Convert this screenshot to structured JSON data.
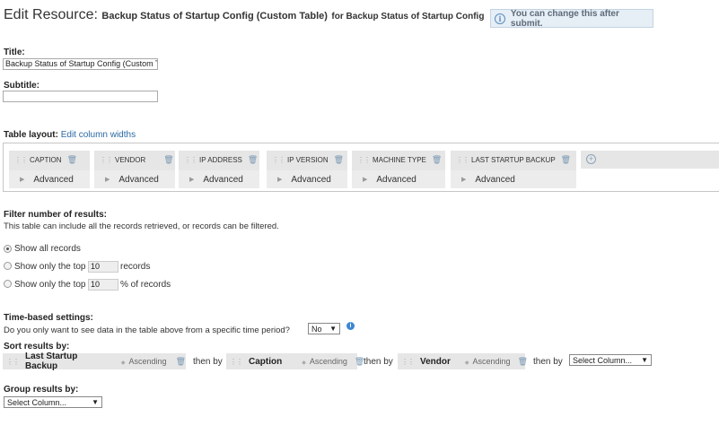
{
  "header": {
    "prefix": "Edit Resource:",
    "resource_name": "Backup Status of Startup Config (Custom Table)",
    "for_text": "for Backup Status of Startup Config",
    "hint": "You can change this after submit."
  },
  "form": {
    "title_label": "Title:",
    "title_value": "Backup Status of Startup Config (Custom Table)",
    "subtitle_label": "Subtitle:",
    "subtitle_value": ""
  },
  "table_layout": {
    "label": "Table layout:",
    "edit_link": "Edit column widths",
    "columns": [
      {
        "name": "CAPTION",
        "advanced": "Advanced"
      },
      {
        "name": "VENDOR",
        "advanced": "Advanced"
      },
      {
        "name": "IP ADDRESS",
        "advanced": "Advanced"
      },
      {
        "name": "IP VERSION",
        "advanced": "Advanced"
      },
      {
        "name": "MACHINE TYPE",
        "advanced": "Advanced"
      },
      {
        "name": "LAST STARTUP BACKUP",
        "advanced": "Advanced"
      }
    ]
  },
  "filter": {
    "label": "Filter number of results:",
    "description": "This table can include all the records retrieved, or records can be filtered.",
    "options": {
      "all": "Show all records",
      "top_prefix": "Show only the top",
      "top_value": "10",
      "top_suffix": "records",
      "pct_prefix": "Show only the top",
      "pct_value": "10",
      "pct_suffix": "% of records"
    },
    "selected": "all"
  },
  "time": {
    "label": "Time-based settings:",
    "question": "Do you only want to see data in the table above from a specific time period?",
    "value": "No"
  },
  "sort": {
    "label": "Sort results by:",
    "then_by": "then by",
    "items": [
      {
        "column": "Last Startup Backup",
        "direction": "Ascending"
      },
      {
        "column": "Caption",
        "direction": "Ascending"
      },
      {
        "column": "Vendor",
        "direction": "Ascending"
      }
    ],
    "select_placeholder": "Select Column..."
  },
  "group": {
    "label": "Group results by:",
    "select_placeholder": "Select Column..."
  },
  "icons": {
    "hint": "info-icon",
    "trash": "trash-icon",
    "grip": "drag-handle-icon",
    "add": "add-column-icon"
  }
}
